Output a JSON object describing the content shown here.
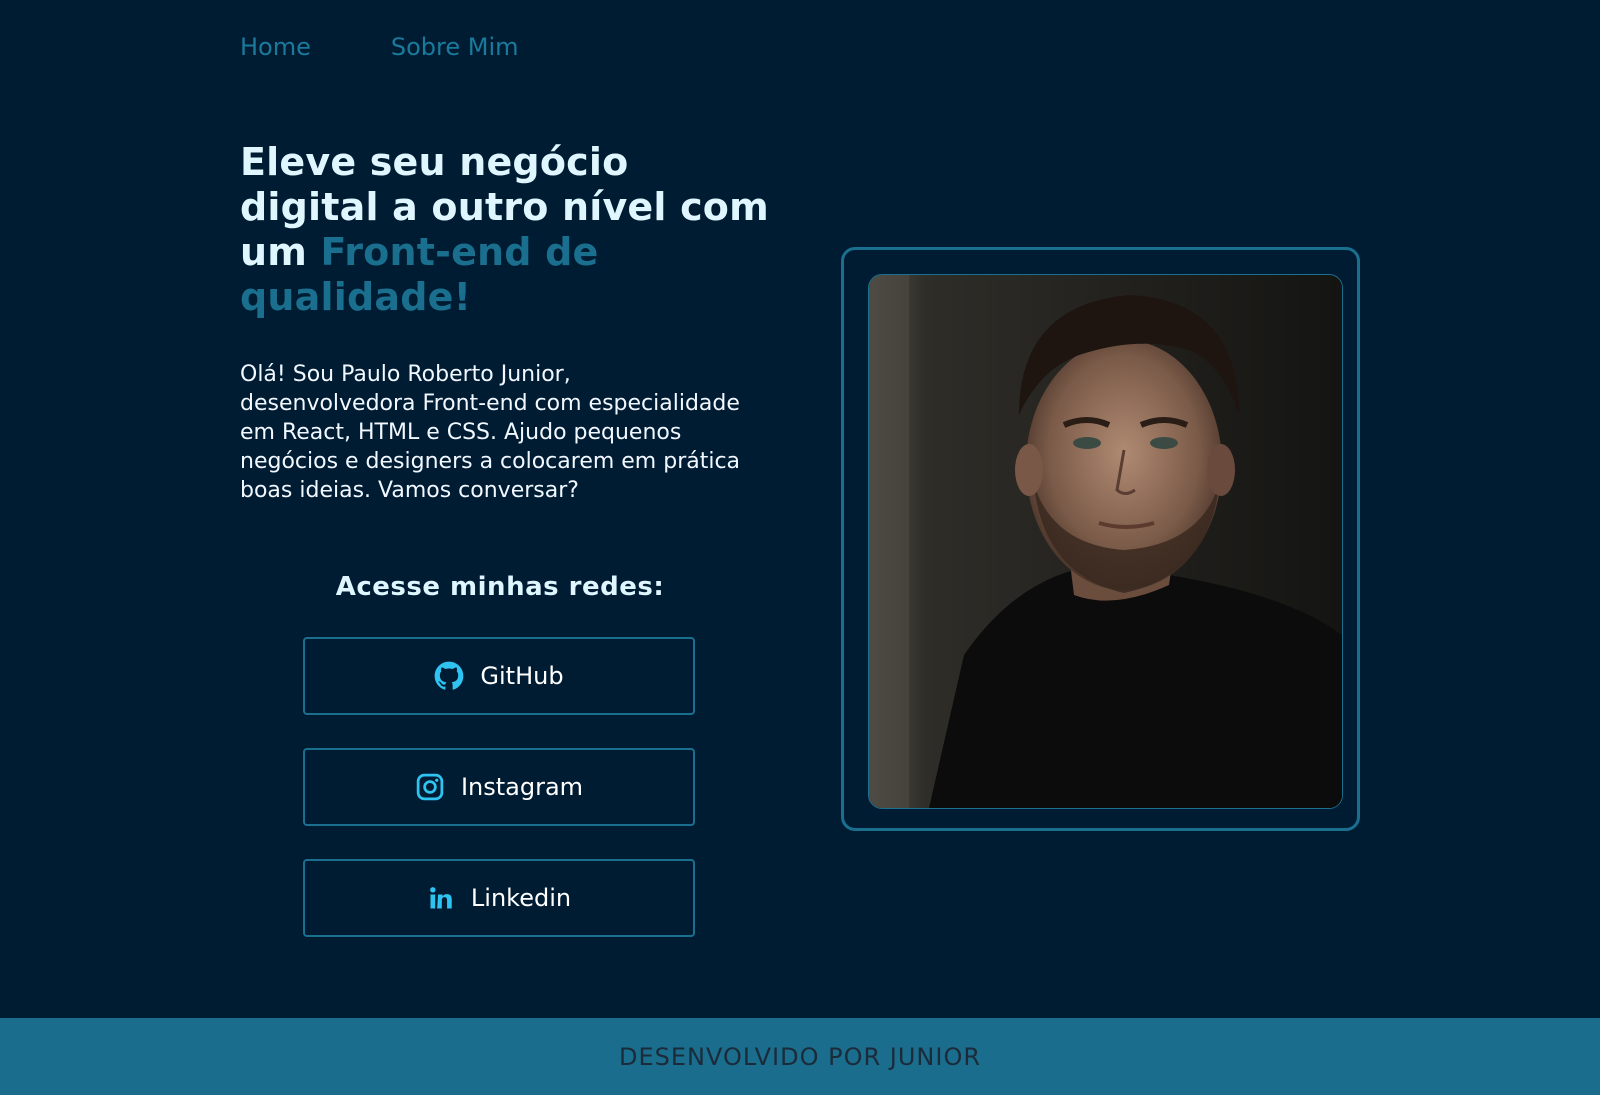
{
  "nav": {
    "items": [
      {
        "label": "Home"
      },
      {
        "label": "Sobre Mim"
      }
    ]
  },
  "hero": {
    "headline_plain": "Eleve seu negócio digital a outro nível com um",
    "headline_accent": "Front-end de qualidade!",
    "intro": "Olá! Sou Paulo Roberto Junior, desenvolvedora Front-end com especialidade em React, HTML e CSS. Ajudo pequenos negócios e designers a colocarem em prática boas ideias. Vamos conversar?"
  },
  "socials": {
    "title": "Acesse minhas redes:",
    "items": [
      {
        "label": "GitHub",
        "icon": "github-icon"
      },
      {
        "label": "Instagram",
        "icon": "instagram-icon"
      },
      {
        "label": "Linkedin",
        "icon": "linkedin-icon"
      }
    ]
  },
  "footer": {
    "text": "DESENVOLVIDO POR JUNIOR"
  },
  "colors": {
    "background": "#001c33",
    "accent": "#1a6f8e",
    "icon": "#2ec3f0",
    "footer_bg": "#1a6d8c"
  }
}
